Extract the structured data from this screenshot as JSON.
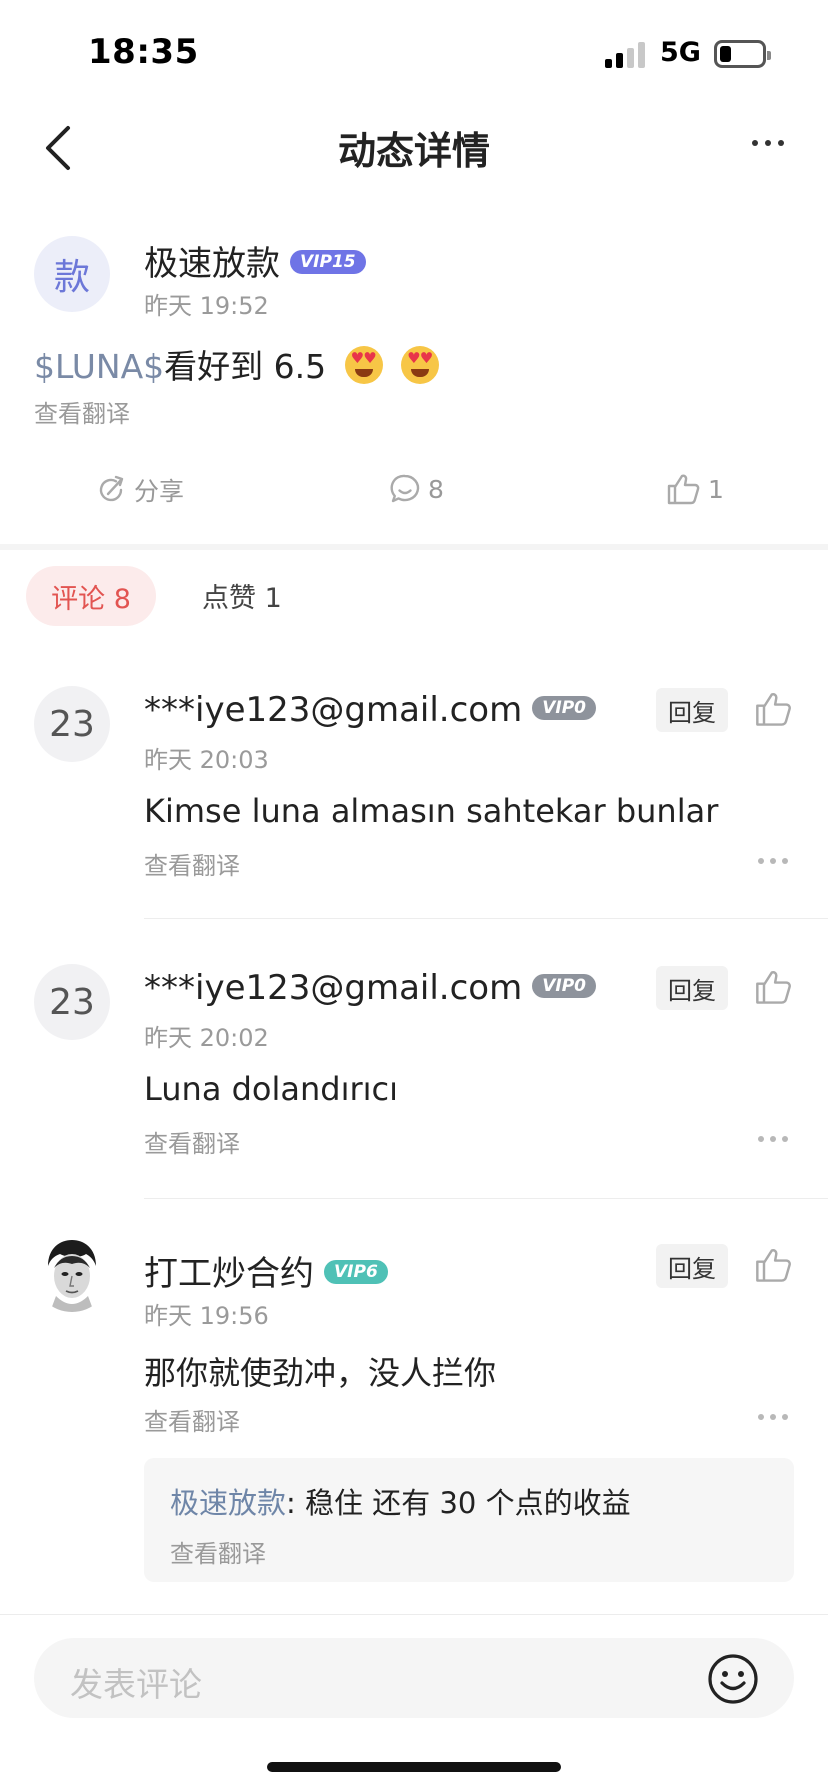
{
  "status_bar": {
    "time": "18:35",
    "network": "5G"
  },
  "nav": {
    "title": "动态详情"
  },
  "post": {
    "avatar_text": "款",
    "author": "极速放款",
    "vip": "VIP15",
    "time": "昨天 19:52",
    "cashtag": "$LUNA$",
    "text": "看好到 6.5",
    "emojis": [
      "heart-eyes-emoji",
      "heart-eyes-emoji"
    ],
    "translate": "查看翻译",
    "share_label": "分享",
    "comment_count": "8",
    "like_count": "1"
  },
  "tabs": {
    "comments": "评论 8",
    "likes": "点赞 1"
  },
  "comments": [
    {
      "avatar_text": "23",
      "author": "***iye123@gmail.com",
      "vip": "VIP0",
      "time": "昨天 20:03",
      "text": "Kimse luna almasın sahtekar bunlar",
      "translate": "查看翻译",
      "reply_label": "回复"
    },
    {
      "avatar_text": "23",
      "author": "***iye123@gmail.com",
      "vip": "VIP0",
      "time": "昨天 20:02",
      "text": "Luna dolandırıcı",
      "translate": "查看翻译",
      "reply_label": "回复"
    },
    {
      "author": "打工炒合约",
      "vip": "VIP6",
      "time": "昨天 19:56",
      "text": "那你就使劲冲，没人拦你",
      "translate": "查看翻译",
      "reply_label": "回复",
      "reply": {
        "author": "极速放款",
        "separator": ": ",
        "text": "稳住 还有 30 个点的收益",
        "translate": "查看翻译"
      }
    }
  ],
  "composer": {
    "placeholder": "发表评论"
  },
  "colors": {
    "vip15": "#6f74e6",
    "vip0": "#8e939c",
    "vip6": "#4fc1b6",
    "accent_red": "#e25451",
    "cashtag": "#7a8aa6"
  }
}
